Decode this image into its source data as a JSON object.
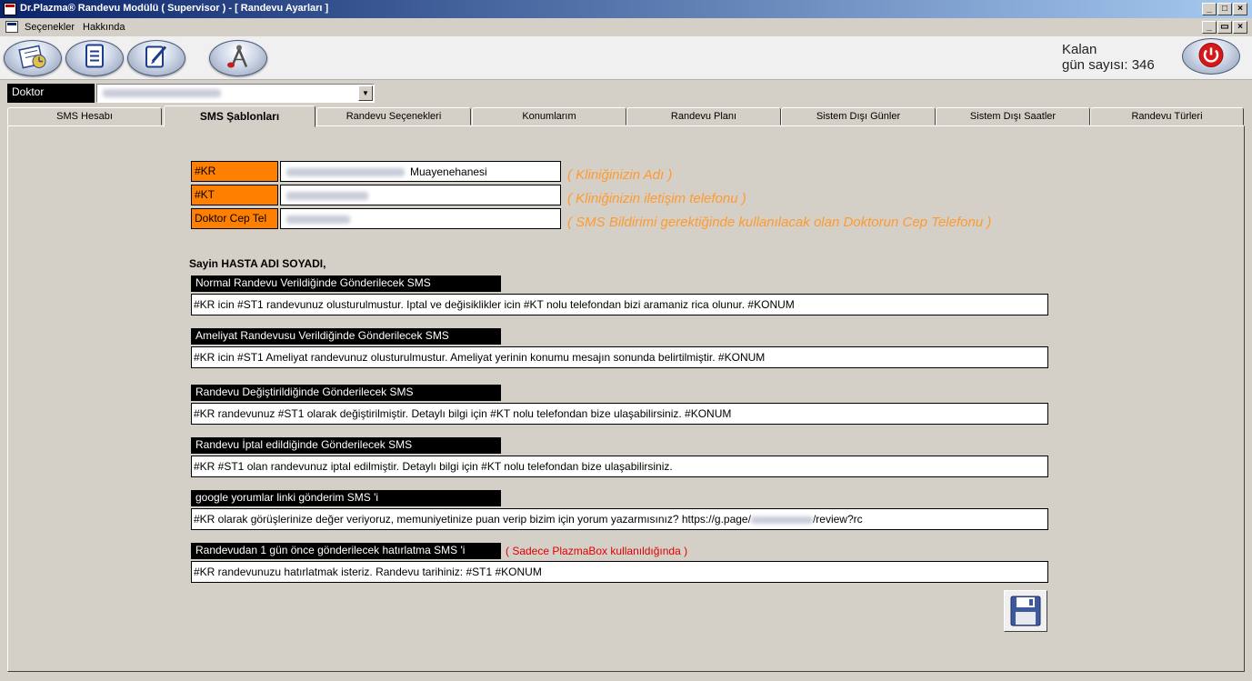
{
  "window": {
    "title": "Dr.Plazma® Randevu Modülü ( Supervisor ) - [ Randevu Ayarları ]",
    "controls": [
      "_",
      "□",
      "×"
    ],
    "mdi_controls": [
      "_",
      "▭",
      "×"
    ]
  },
  "menu": {
    "items": [
      "Seçenekler",
      "Hakkında"
    ]
  },
  "toolbar": {
    "buttons": [
      "calendar-icon",
      "document-icon",
      "edit-icon",
      "compass-icon"
    ],
    "kalan_line1": "Kalan",
    "kalan_line2": "gün sayısı: 346",
    "exit_icon": "power-icon"
  },
  "doctor": {
    "label": "Doktor"
  },
  "tabs": [
    {
      "label": "SMS Hesabı",
      "active": false
    },
    {
      "label": "SMS Şablonları",
      "active": true
    },
    {
      "label": "Randevu Seçenekleri",
      "active": false
    },
    {
      "label": "Konumlarım",
      "active": false
    },
    {
      "label": "Randevu Planı",
      "active": false
    },
    {
      "label": "Sistem Dışı Günler",
      "active": false
    },
    {
      "label": "Sistem Dışı Saatler",
      "active": false
    },
    {
      "label": "Randevu Türleri",
      "active": false
    }
  ],
  "variables": [
    {
      "label": "#KR",
      "value_suffix": "Muayenehanesi",
      "hint": "( Kliniğinizin Adı )"
    },
    {
      "label": "#KT",
      "value_suffix": "",
      "hint": "( Kliniğinizin iletişim telefonu )"
    },
    {
      "label": "Doktor Cep Tel",
      "value_suffix": "",
      "hint": "( SMS Bildirimi gerektiğinde kullanılacak olan Doktorun Cep Telefonu )"
    }
  ],
  "greeting": "Sayin HASTA ADI SOYADI,",
  "templates": [
    {
      "title": "Normal Randevu Verildiğinde Gönderilecek SMS",
      "text": "#KR icin #ST1 randevunuz olusturulmustur. Iptal ve değisiklikler icin #KT nolu telefondan bizi aramaniz rica olunur. #KONUM"
    },
    {
      "title": "Ameliyat Randevusu Verildiğinde Gönderilecek SMS",
      "text": "#KR icin #ST1 Ameliyat randevunuz olusturulmustur. Ameliyat yerinin konumu mesajın sonunda belirtilmiştir. #KONUM"
    },
    {
      "title": "Randevu Değiştirildiğinde Gönderilecek SMS",
      "text": "#KR randevunuz #ST1 olarak değiştirilmiştir. Detaylı bilgi için #KT nolu telefondan bize ulaşabilirsiniz. #KONUM"
    },
    {
      "title": "Randevu İptal edildiğinde Gönderilecek SMS",
      "text": "#KR #ST1 olan randevunuz iptal edilmiştir. Detaylı bilgi için #KT nolu telefondan bize ulaşabilirsiniz."
    },
    {
      "title": "google yorumlar linki gönderim SMS 'i",
      "text_prefix": "#KR olarak görüşlerinize değer veriyoruz, memuniyetinize puan verip bizim için yorum yazarmısınız? https://g.page/",
      "text_suffix": "/review?rc"
    },
    {
      "title": "Randevudan 1 gün önce gönderilecek hatırlatma SMS 'i",
      "note": "( Sadece PlazmaBox kullanıldığında )",
      "text": "#KR randevunuzu hatırlatmak isteriz. Randevu tarihiniz: #ST1 #KONUM"
    }
  ],
  "save_icon": "floppy-disk-icon",
  "colors": {
    "variable_label_bg": "#ff8000",
    "hint_text": "#ff9a2e",
    "note_text": "#e00000",
    "title_gradient_start": "#0a246a"
  }
}
